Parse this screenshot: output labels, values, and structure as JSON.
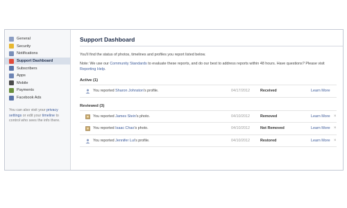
{
  "sidebar": {
    "items": [
      {
        "label": "General",
        "icon": "gear-icon",
        "color": "#8b9dc3",
        "active": false
      },
      {
        "label": "Security",
        "icon": "lock-icon",
        "color": "#e7b730",
        "active": false
      },
      {
        "label": "Notifications",
        "icon": "notification-icon",
        "color": "#7a8fb8",
        "active": false
      },
      {
        "label": "Support Dashboard",
        "icon": "support-icon",
        "color": "#e24b3b",
        "active": true
      },
      {
        "label": "Subscribers",
        "icon": "subscribers-icon",
        "color": "#5b74a8",
        "active": false
      },
      {
        "label": "Apps",
        "icon": "apps-icon",
        "color": "#6d84b4",
        "active": false
      },
      {
        "label": "Mobile",
        "icon": "mobile-icon",
        "color": "#4a4a4a",
        "active": false
      },
      {
        "label": "Payments",
        "icon": "payments-icon",
        "color": "#6a8f3c",
        "active": false
      },
      {
        "label": "Facebook Ads",
        "icon": "ads-icon",
        "color": "#5b74a8",
        "active": false
      }
    ],
    "note": {
      "part1": "You can also visit your ",
      "link1": "privacy settings",
      "part2": " or edit your ",
      "link2": "timeline",
      "part3": " to control who sees the info there."
    }
  },
  "main": {
    "title": "Support Dashboard",
    "intro": "You'll find the status of photos, timelines and profiles you report listed below.",
    "note": {
      "part1": "Note: We use our ",
      "link1": "Community Standards",
      "part2": " to evaluate these reports, and do our best to address reports within 48 hours. Have questions? Please visit ",
      "link2": "Reporting Help",
      "part3": "."
    },
    "active": {
      "heading": "Active (1)",
      "rows": [
        {
          "prefix": "You reported ",
          "name": "Sharon Johnston",
          "suffix": "'s profile.",
          "date": "04/17/2012",
          "status": "Received",
          "learn": "Learn More",
          "icon": "profile-icon",
          "dismiss": ""
        }
      ]
    },
    "reviewed": {
      "heading": "Reviewed (3)",
      "rows": [
        {
          "prefix": "You reported ",
          "name": "James Stein",
          "suffix": "'s photo.",
          "date": "04/10/2012",
          "status": "Removed",
          "learn": "Learn More",
          "icon": "photo-icon",
          "dismiss": "×"
        },
        {
          "prefix": "You reported ",
          "name": "Isaac Chao",
          "suffix": "'s photo.",
          "date": "04/10/2012",
          "status": "Not Removed",
          "learn": "Learn More",
          "icon": "photo-icon",
          "dismiss": "×"
        },
        {
          "prefix": "You reported ",
          "name": "Jennifer Lui",
          "suffix": "'s profile.",
          "date": "04/10/2012",
          "status": "Restored",
          "learn": "Learn More",
          "icon": "profile-icon",
          "dismiss": "×"
        }
      ]
    }
  }
}
